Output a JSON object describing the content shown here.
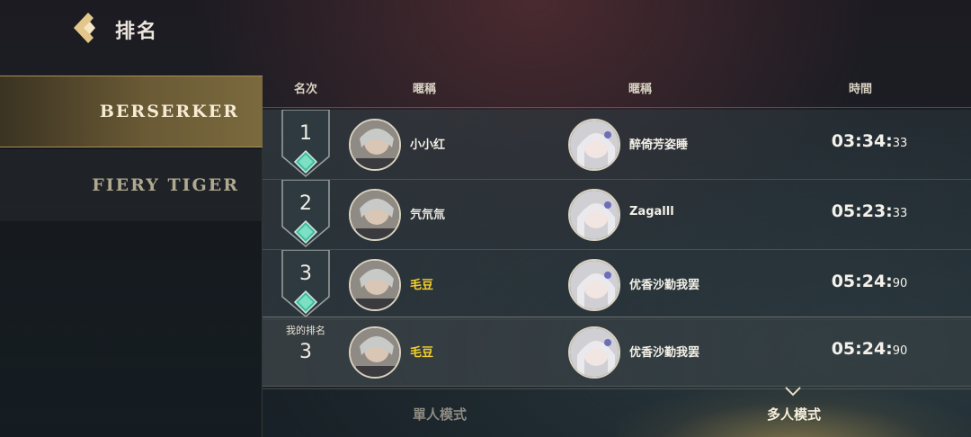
{
  "header": {
    "title": "排名"
  },
  "sidebar": {
    "items": [
      {
        "label": "BERSERKER",
        "active": true
      },
      {
        "label": "FIERY TIGER",
        "active": false
      }
    ]
  },
  "table": {
    "columns": {
      "rank": "名次",
      "name1": "暱稱",
      "name2": "暱稱",
      "time": "時間"
    },
    "rows": [
      {
        "rank": "1",
        "name1": "小小红",
        "name2": "醉倚芳姿睡",
        "time_main": "03:34:",
        "time_ms": "33"
      },
      {
        "rank": "2",
        "name1": "氕氘氚",
        "name2": "Zagalll",
        "time_main": "05:23:",
        "time_ms": "33"
      },
      {
        "rank": "3",
        "name1": "毛豆",
        "name2": "优香沙勤我罢",
        "time_main": "05:24:",
        "time_ms": "90"
      }
    ],
    "mine": {
      "label": "我的排名",
      "rank": "3",
      "name1": "毛豆",
      "name2": "优香沙勤我罢",
      "time_main": "05:24:",
      "time_ms": "90"
    }
  },
  "footer": {
    "tabs": [
      {
        "label": "單人模式",
        "active": false
      },
      {
        "label": "多人模式",
        "active": true
      }
    ]
  },
  "colors": {
    "highlight_name": "#f6d02a",
    "gold": "#a88f55",
    "badge_gem": "#3fbfa0"
  }
}
